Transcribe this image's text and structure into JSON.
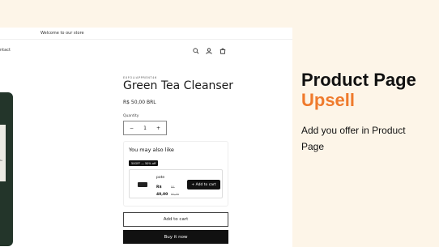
{
  "store": {
    "announcement": "Welcome to our store",
    "nav_contact": "ntact",
    "icons": {
      "search": "search-icon",
      "account": "user-icon",
      "cart": "cart-icon"
    }
  },
  "product": {
    "vendor": "EXFOLIAPPRENT46",
    "title": "Green Tea Cleanser",
    "price": "R$ 50,00 BRL",
    "quantity_label": "Quantity",
    "quantity_value": "1",
    "minus": "−",
    "plus": "+",
    "bottle_label": "te"
  },
  "upsell": {
    "heading": "You may also like",
    "badge": "50OFF — 50% off",
    "item_name": "pote",
    "item_price": "R$ 40,00",
    "item_compare_price": "R$ 80,00",
    "add_button": "+ Add to cart"
  },
  "actions": {
    "add_to_cart": "Add to cart",
    "buy_now": "Buy it now"
  },
  "promo": {
    "title_line1": "Product Page",
    "title_line2": "Upsell",
    "subtitle": "Add you offer in Product Page"
  },
  "colors": {
    "background": "#fdf5e8",
    "accent": "#ef7a2c",
    "button_dark": "#111111",
    "bottle": "#23352a"
  }
}
